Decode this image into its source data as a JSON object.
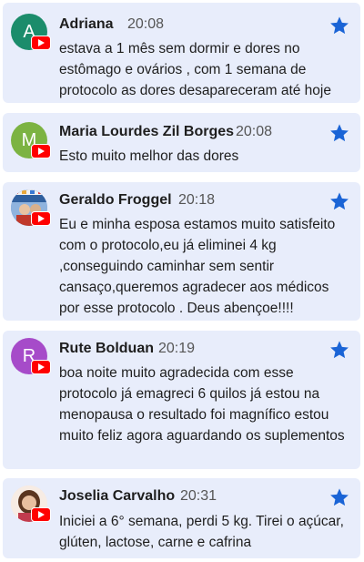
{
  "colors": {
    "card_background": "#e8edfb",
    "star": "#1a64d6",
    "youtube_badge": "#ff0000"
  },
  "comments": [
    {
      "avatar_letter": "A",
      "avatar_color": "#1b8c6b",
      "author": "Adriana",
      "time": "20:08",
      "text": "estava a 1 mês sem dormir e dores no estômago e ovários , com 1 semana de protocolo as dores desapareceram até hoje",
      "starred": true
    },
    {
      "avatar_letter": "M",
      "avatar_color": "#7cb342",
      "author": "Maria Lourdes Zil Borges",
      "time": "20:08",
      "text": "Esto muito melhor das dores",
      "starred": true
    },
    {
      "avatar_letter": "",
      "avatar_icon": "photo-avatar",
      "author": "Geraldo Froggel",
      "time": "20:18",
      "text": "Eu e minha esposa estamos muito satisfeito com o protocolo,eu já eliminei 4 kg ,conseguindo caminhar sem sentir cansaço,queremos agradecer aos médicos por esse protocolo . Deus abençoe!!!!",
      "starred": true
    },
    {
      "avatar_letter": "R",
      "avatar_color": "#a64bc9",
      "author": "Rute Bolduan",
      "time": "20:19",
      "text": "boa noite muito agradecida com esse protocolo já emagreci 6 quilos já estou na menopausa o resultado foi magnífico estou muito feliz agora aguardando os suplementos",
      "starred": true
    },
    {
      "avatar_letter": "",
      "avatar_icon": "photo-avatar",
      "author": "Joselia Carvalho",
      "time": "20:31",
      "text": "Iniciei a 6° semana, perdi 5 kg. Tirei o açúcar, glúten, lactose, carne e cafrina",
      "starred": true
    }
  ]
}
